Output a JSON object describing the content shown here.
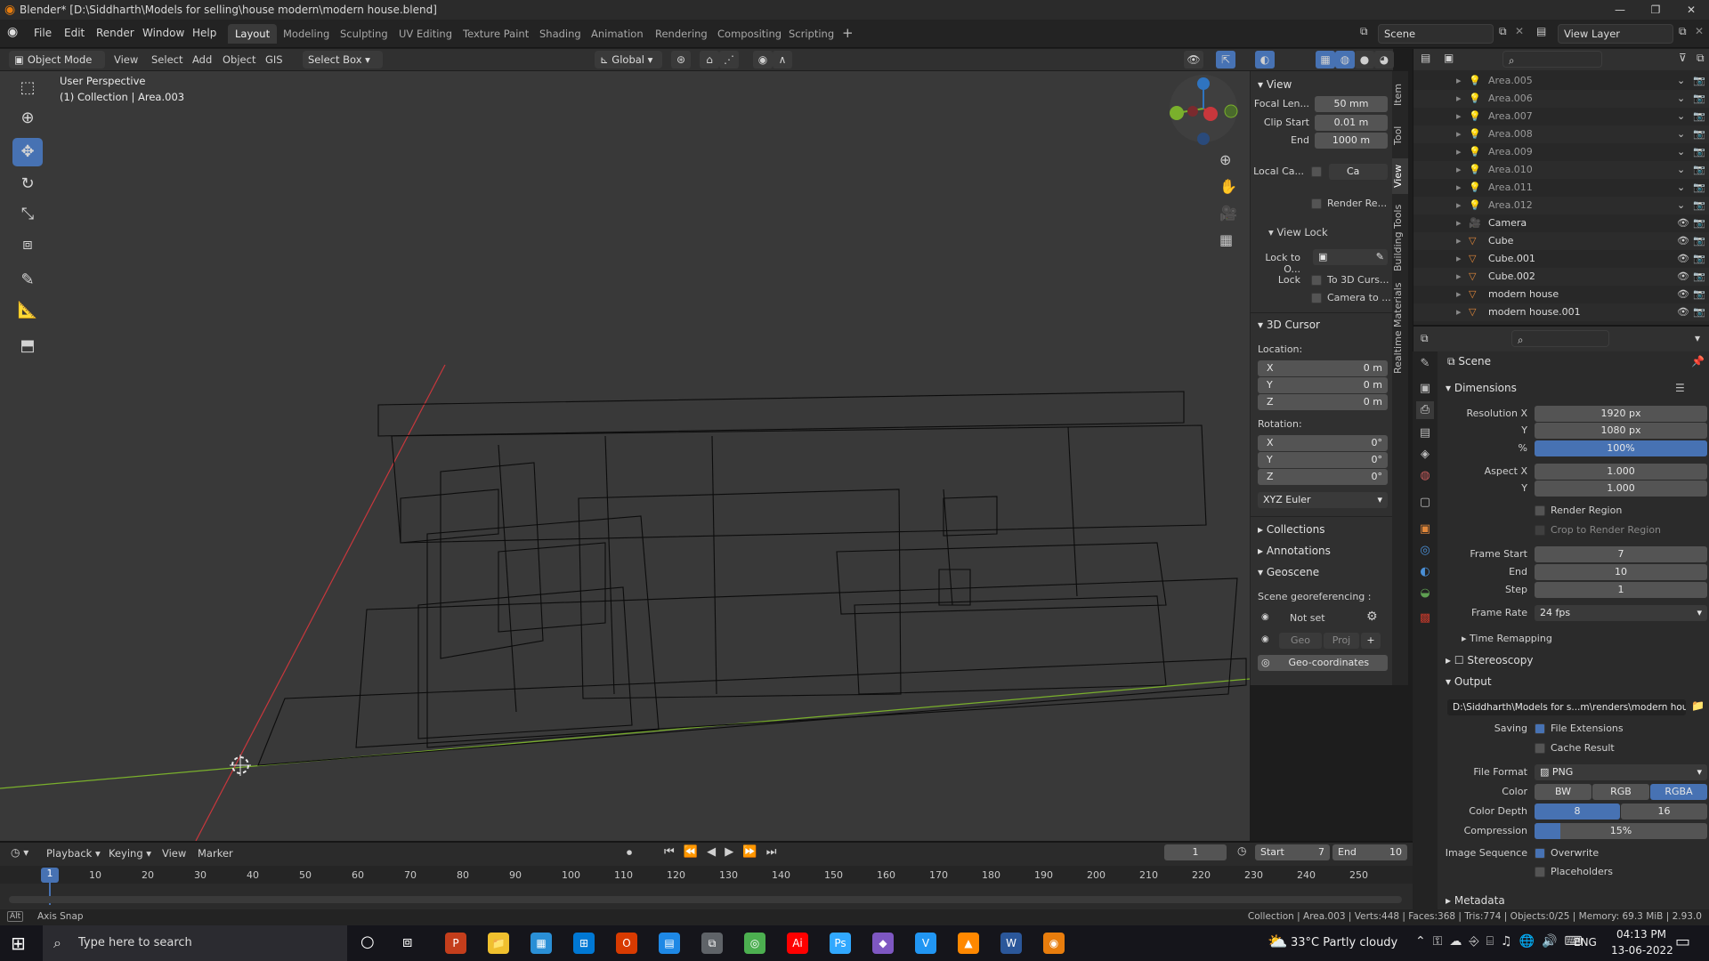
{
  "title": "Blender* [D:\\Siddharth\\Models for selling\\house modern\\modern house.blend]",
  "menu": [
    "File",
    "Edit",
    "Render",
    "Window",
    "Help"
  ],
  "workspaces": [
    "Layout",
    "Modeling",
    "Sculpting",
    "UV Editing",
    "Texture Paint",
    "Shading",
    "Animation",
    "Rendering",
    "Compositing",
    "Scripting"
  ],
  "active_workspace": "Layout",
  "scene_name": "Scene",
  "view_layer": "View Layer",
  "header": {
    "mode": "Object Mode",
    "view": "View",
    "select": "Select",
    "add": "Add",
    "object": "Object",
    "gis": "GIS",
    "select_box": "Select Box",
    "transform": "Global"
  },
  "viewport": {
    "perspective": "User Perspective",
    "collection": "(1) Collection | Area.003"
  },
  "npanel": {
    "view_header": "View",
    "focal_label": "Focal Len...",
    "focal": "50 mm",
    "clip_start_label": "Clip Start",
    "clip_start": "0.01 m",
    "end_label": "End",
    "clip_end": "1000 m",
    "local_cam_label": "Local Ca...",
    "local_cam_value": "Ca",
    "render_region": "Render Re...",
    "view_lock": "View Lock",
    "lock_to_label": "Lock to O...",
    "lock_label": "Lock",
    "to_3d_cursor": "To 3D Curs...",
    "camera_to": "Camera to ...",
    "cursor_header": "3D Cursor",
    "location": "Location:",
    "rotation": "Rotation:",
    "x": "X",
    "y": "Y",
    "z": "Z",
    "loc_x": "0 m",
    "loc_y": "0 m",
    "loc_z": "0 m",
    "rot_x": "0°",
    "rot_y": "0°",
    "rot_z": "0°",
    "rot_mode": "XYZ Euler",
    "collections": "Collections",
    "annotations": "Annotations",
    "geoscene": "Geoscene",
    "georef": "Scene georeferencing :",
    "not_set": "Not set",
    "geo": "Geo",
    "proj": "Proj",
    "geo_coords": "Geo-coordinates",
    "tabs": [
      "Item",
      "Tool",
      "View",
      "Building Tools",
      "Realtime Materials"
    ]
  },
  "outliner": {
    "rows": [
      {
        "name": "Area.005",
        "type": "light"
      },
      {
        "name": "Area.006",
        "type": "light"
      },
      {
        "name": "Area.007",
        "type": "light"
      },
      {
        "name": "Area.008",
        "type": "light"
      },
      {
        "name": "Area.009",
        "type": "light"
      },
      {
        "name": "Area.010",
        "type": "light"
      },
      {
        "name": "Area.011",
        "type": "light"
      },
      {
        "name": "Area.012",
        "type": "light"
      },
      {
        "name": "Camera",
        "type": "camera"
      },
      {
        "name": "Cube",
        "type": "mesh"
      },
      {
        "name": "Cube.001",
        "type": "mesh"
      },
      {
        "name": "Cube.002",
        "type": "mesh"
      },
      {
        "name": "modern house",
        "type": "mesh"
      },
      {
        "name": "modern house.001",
        "type": "mesh"
      }
    ]
  },
  "props": {
    "scene": "Scene",
    "dimensions": "Dimensions",
    "res_x_label": "Resolution X",
    "res_x": "1920 px",
    "y_label": "Y",
    "res_y": "1080 px",
    "pct_label": "%",
    "pct": "100%",
    "aspect_x_label": "Aspect X",
    "aspect_x": "1.000",
    "aspect_y": "1.000",
    "render_region": "Render Region",
    "crop": "Crop to Render Region",
    "frame_start_label": "Frame Start",
    "frame_start": "7",
    "end_label": "End",
    "frame_end": "10",
    "step_label": "Step",
    "step": "1",
    "frame_rate_label": "Frame Rate",
    "frame_rate": "24 fps",
    "time_remap": "Time Remapping",
    "stereoscopy": "Stereoscopy",
    "output": "Output",
    "output_path": "D:\\Siddharth\\Models for s...m\\renders\\modern house",
    "saving_label": "Saving",
    "file_ext": "File Extensions",
    "cache": "Cache Result",
    "file_format_label": "File Format",
    "file_format": "PNG",
    "color_label": "Color",
    "bw": "BW",
    "rgb": "RGB",
    "rgba": "RGBA",
    "depth_label": "Color Depth",
    "d8": "8",
    "d16": "16",
    "comp_label": "Compression",
    "comp": "15%",
    "comp_fraction": 0.15,
    "img_seq_label": "Image Sequence",
    "overwrite": "Overwrite",
    "placeholders": "Placeholders",
    "metadata": "Metadata"
  },
  "timeline": {
    "playback": "Playback",
    "keying": "Keying",
    "view": "View",
    "marker": "Marker",
    "current_frame": "1",
    "start_label": "Start",
    "start": "7",
    "end_label": "End",
    "end": "10",
    "ticks": [
      "10",
      "20",
      "30",
      "40",
      "50",
      "60",
      "70",
      "80",
      "90",
      "100",
      "110",
      "120",
      "130",
      "140",
      "150",
      "160",
      "170",
      "180",
      "190",
      "200",
      "210",
      "220",
      "230",
      "240",
      "250"
    ],
    "current_marker": "1"
  },
  "status": {
    "left": "Axis Snap",
    "right": "Collection | Area.003 | Verts:448 | Faces:368 | Tris:774 | Objects:0/25 | Memory: 69.3 MiB | 2.93.0"
  },
  "taskbar": {
    "search": "Type here to search",
    "weather": "33°C  Partly cloudy",
    "lang": "ENG",
    "time": "04:13 PM",
    "date": "13-06-2022",
    "app_colors": [
      "#c43e1c",
      "#f0c02e",
      "#2a8fd6",
      "#0078d4",
      "#d83b01",
      "#1e88e5",
      "#5f6368",
      "#4caf50",
      "#ff0000",
      "#31a8ff",
      "#7e57c2",
      "#2196f3",
      "#ff8800",
      "#2b579a",
      "#e87d0d"
    ]
  },
  "colors": {
    "accent": "#4772b3",
    "x_axis": "#c8373c",
    "y_axis": "#7ab02c",
    "z_axis": "#2f74c0"
  }
}
